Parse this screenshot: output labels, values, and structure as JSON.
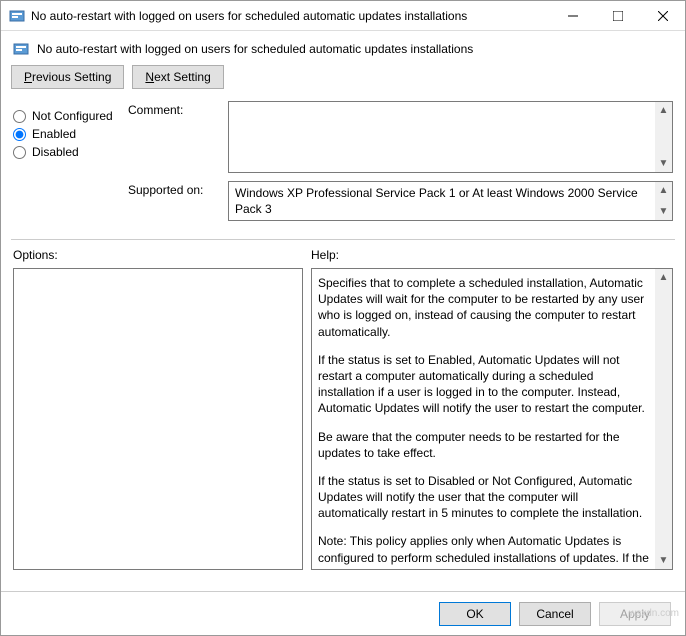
{
  "window": {
    "title": "No auto-restart with logged on users for scheduled automatic updates installations"
  },
  "subtitle": "No auto-restart with logged on users for scheduled automatic updates installations",
  "buttons": {
    "prevPrefix": "P",
    "prevRest": "revious Setting",
    "nextPrefix": "N",
    "nextRest": "ext Setting",
    "ok": "OK",
    "cancel": "Cancel",
    "apply": "Apply"
  },
  "radios": {
    "notConfigured": "Not Configured",
    "enabled": "Enabled",
    "disabled": "Disabled",
    "selected": "enabled"
  },
  "fields": {
    "commentLabel": "Comment:",
    "commentValue": "",
    "supportedLabel": "Supported on:",
    "supportedValue": "Windows XP Professional Service Pack 1 or At least Windows 2000 Service Pack 3"
  },
  "columns": {
    "optionsLabel": "Options:",
    "helpLabel": "Help:"
  },
  "help": {
    "p1": "Specifies that to complete a scheduled installation, Automatic Updates will wait for the computer to be restarted by any user who is logged on, instead of causing the computer to restart automatically.",
    "p2": "If the status is set to Enabled, Automatic Updates will not restart a computer automatically during a scheduled installation if a user is logged in to the computer. Instead, Automatic Updates will notify the user to restart the computer.",
    "p3": "Be aware that the computer needs to be restarted for the updates to take effect.",
    "p4": "If the status is set to Disabled or Not Configured, Automatic Updates will notify the user that the computer will automatically restart in 5 minutes to complete the installation.",
    "p5": "Note: This policy applies only when Automatic Updates is configured to perform scheduled installations of updates. If the"
  },
  "watermark": "wsxdn.com"
}
